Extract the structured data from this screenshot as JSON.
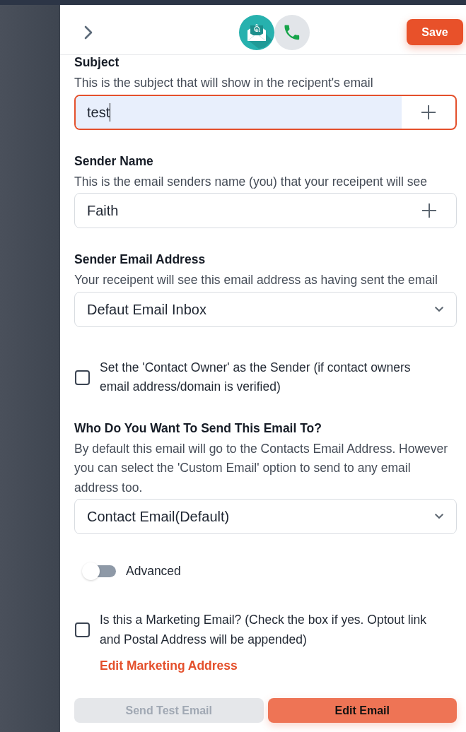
{
  "header": {
    "channel_tabs": [
      {
        "kind": "email",
        "selected": true
      },
      {
        "kind": "phone",
        "selected": false
      }
    ],
    "save_button": "Save"
  },
  "sections": [
    {
      "kind": "text_field",
      "label": "Subject",
      "description": "This is the subject that will show in the recipent's email",
      "value": "test",
      "focused": true
    },
    {
      "kind": "text_field",
      "label": "Sender Name",
      "description": "This is the email senders name (you) that your receipent will see",
      "value": "Faith",
      "focused": false
    },
    {
      "kind": "select",
      "label": "Sender Email Address",
      "description": "Your receipent will see this email address as having sent the email",
      "value": "Defaut Email Inbox"
    },
    {
      "kind": "checkbox",
      "text": "Set the 'Contact Owner' as the Sender (if contact owners email address/domain is verified)",
      "checked": false
    },
    {
      "kind": "select",
      "label": "Who Do You Want To Send This Email To?",
      "description": "By default this email will go to the Contacts Email Address. However you can select the 'Custom Email' option to send to any email address too.",
      "value": "Contact Email(Default)"
    },
    {
      "kind": "toggle",
      "label": "Advanced",
      "on": false
    },
    {
      "kind": "checkbox",
      "text": "Is this a Marketing Email? (Check the box if yes. Optout link and Postal Address will be appended)",
      "checked": false,
      "link": "Edit Marketing Address"
    }
  ],
  "footer_buttons": [
    {
      "label": "Send Test Email",
      "disabled": true
    },
    {
      "label": "Edit Email",
      "disabled": false
    }
  ]
}
